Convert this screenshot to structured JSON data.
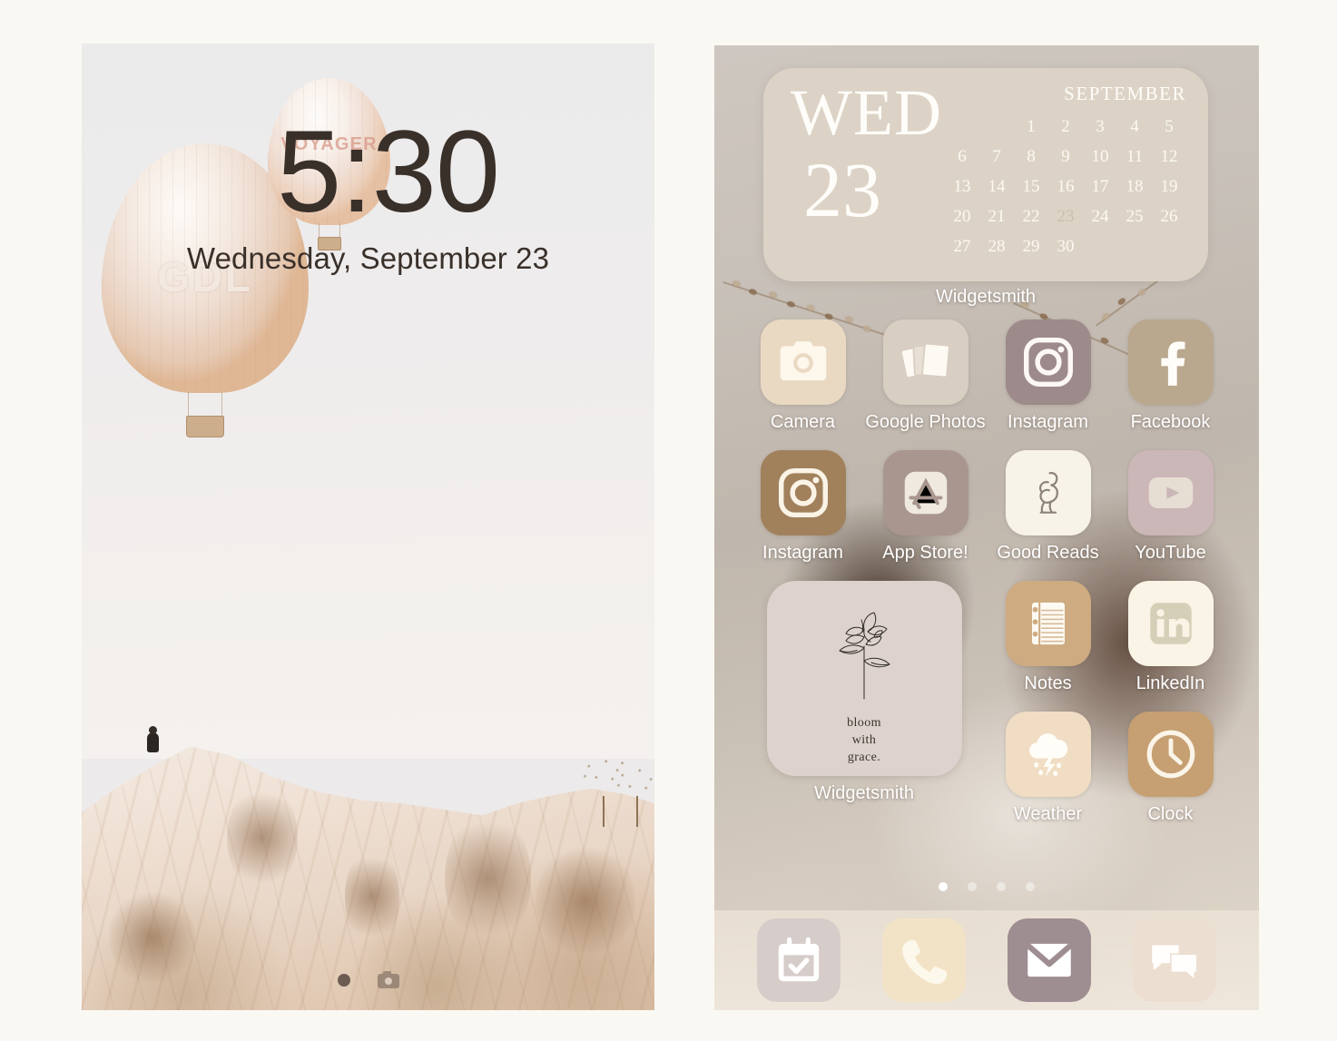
{
  "page": {
    "background_color": "#faf8f3"
  },
  "lock_screen": {
    "name": "iPhone Lock Screen",
    "time": "5:30",
    "date": "Wednesday, September 23",
    "wallpaper": {
      "description": "hot air balloons over pale rock landscape",
      "balloon_brands": [
        "GDL",
        "VOYAGER"
      ]
    },
    "bottom": {
      "page_dot": "●",
      "camera_icon": "camera-icon"
    }
  },
  "home_screen": {
    "name": "iPhone Home Screen",
    "calendar_widget": {
      "weekday": "WED",
      "day": "23",
      "month": "SEPTEMBER",
      "today": 23,
      "start_weekday_index": 2,
      "days_in_month": 30,
      "days": [
        1,
        2,
        3,
        4,
        5,
        6,
        7,
        8,
        9,
        10,
        11,
        12,
        13,
        14,
        15,
        16,
        17,
        18,
        19,
        20,
        21,
        22,
        23,
        24,
        25,
        26,
        27,
        28,
        29,
        30
      ],
      "label": "Widgetsmith",
      "bg_color": "#dcd3c6",
      "text_color": "#fffdf9"
    },
    "rows": [
      {
        "cells": [
          {
            "label": "Camera",
            "icon": "camera-icon",
            "bg": "#ead9c2",
            "fg": "#fdf7ec"
          },
          {
            "label": "Google Photos",
            "icon": "photo-stack-icon",
            "bg": "#d9cec2",
            "fg": "#fdfaf4"
          },
          {
            "label": "Instagram",
            "icon": "instagram-icon",
            "bg": "#9d8a8a",
            "fg": "#fdf8f4"
          },
          {
            "label": "Facebook",
            "icon": "facebook-icon",
            "bg": "#b9a78e",
            "fg": "#fffdf8"
          }
        ]
      },
      {
        "cells": [
          {
            "label": "Instagram",
            "icon": "instagram-icon",
            "bg": "#a1815c",
            "fg": "#fbf3e6"
          },
          {
            "label": "App Store!",
            "icon": "app-store-icon",
            "bg": "#a8968f",
            "fg": "#f5efe6"
          },
          {
            "label": "Good Reads",
            "icon": "line-woman-icon",
            "bg": "#f7f3e9",
            "fg": "#8c8278"
          },
          {
            "label": "YouTube",
            "icon": "youtube-icon",
            "bg": "#cbb6b8",
            "fg": "#e6ded2"
          }
        ]
      }
    ],
    "widget_cell": {
      "label": "Widgetsmith",
      "icon": "flower-line-art",
      "quote_lines": [
        "bloom",
        "with",
        "grace."
      ],
      "bg": "#ddd2cd"
    },
    "right_cells": [
      {
        "label": "Notes",
        "icon": "notepad-icon",
        "bg": "#ceab81",
        "fg": "#fbf6ee"
      },
      {
        "label": "LinkedIn",
        "icon": "linkedin-icon",
        "bg": "#faf4e7",
        "fg": "#d6cfb8"
      },
      {
        "label": "Weather",
        "icon": "storm-icon",
        "bg": "#f0ddc4",
        "fg": "#fffdf8"
      },
      {
        "label": "Clock",
        "icon": "clock-icon",
        "bg": "#c69f72",
        "fg": "#fbf4e8"
      }
    ],
    "page_dots": {
      "count": 4,
      "active_index": 0
    },
    "dock": [
      {
        "label": "Calendar",
        "icon": "calendar-check-icon",
        "bg": "#d6ccc9",
        "fg": "#ffffff"
      },
      {
        "label": "Phone",
        "icon": "phone-icon",
        "bg": "#f3e3c6",
        "fg": "#fdf8ec"
      },
      {
        "label": "Mail",
        "icon": "mail-icon",
        "bg": "#9e8d91",
        "fg": "#ffffff"
      },
      {
        "label": "Messages",
        "icon": "messages-icon",
        "bg": "#ecded0",
        "fg": "#fffefc"
      }
    ]
  }
}
